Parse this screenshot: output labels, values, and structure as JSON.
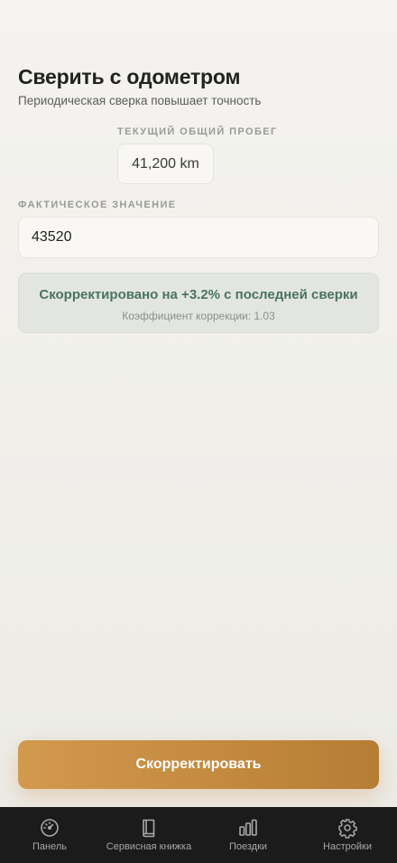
{
  "header": {
    "title": "Сверить с одометром",
    "subtitle": "Периодическая сверка повышает точность"
  },
  "current_total": {
    "label": "ТЕКУЩИЙ ОБЩИЙ ПРОБЕГ",
    "value": "41,200 km"
  },
  "actual": {
    "label": "ФАКТИЧЕСКОЕ ЗНАЧЕНИЕ",
    "value": "43520"
  },
  "result": {
    "main": "Скорректировано на +3.2% с последней сверки",
    "sub": "Коэффициент коррекции: 1.03"
  },
  "primary_action": {
    "label": "Скорректировать"
  },
  "tabbar": {
    "items": [
      {
        "label": "Панель",
        "icon": "speedometer-icon"
      },
      {
        "label": "Сервисная книжка",
        "icon": "book-icon"
      },
      {
        "label": "Поездки",
        "icon": "bar-chart-icon"
      },
      {
        "label": "Настройки",
        "icon": "gear-icon"
      }
    ]
  },
  "colors": {
    "accent": "#c48a3f",
    "success_text": "#4a7264",
    "tabbar_bg": "#1b1b1b"
  }
}
